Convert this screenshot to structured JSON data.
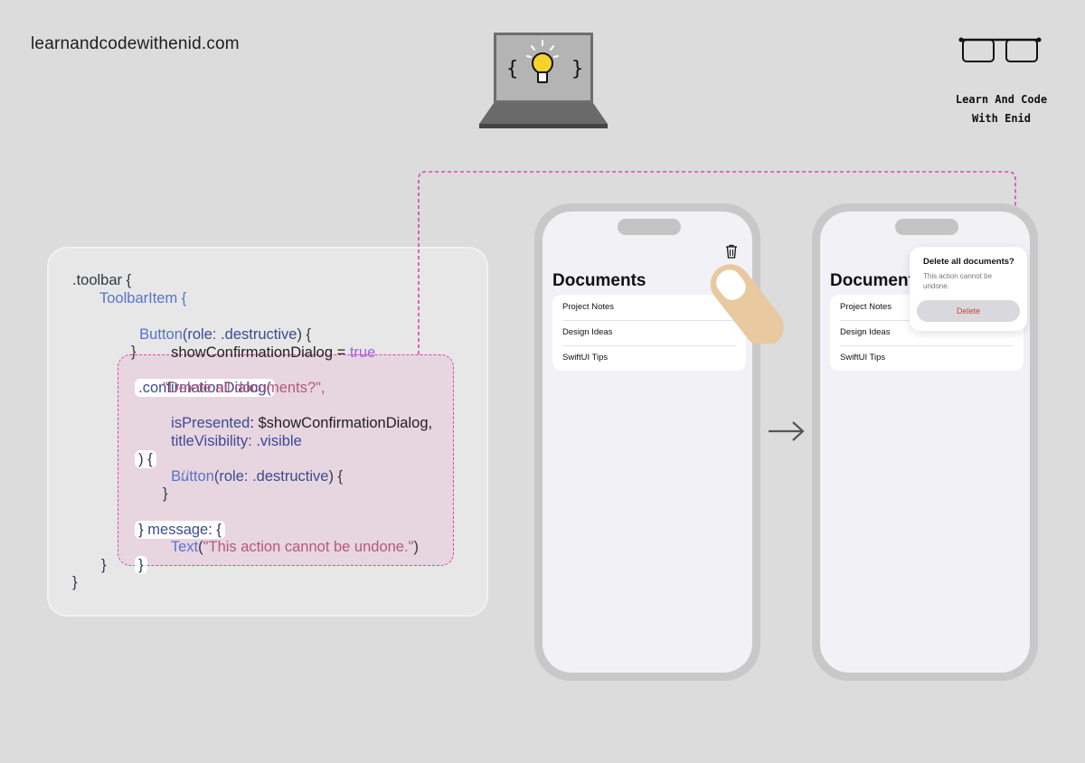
{
  "header": {
    "site_url": "learnandcodewithenid.com",
    "brand_line1": "Learn And Code",
    "brand_line2": "With Enid"
  },
  "code": {
    "l1": ".toolbar {",
    "l2": "ToolbarItem {",
    "l3_a": "Button",
    "l3_b": "(role: ",
    "l3_c": ".destructive",
    "l3_d": ") {",
    "l4_a": "showConfirmationDialog = ",
    "l4_b": "true",
    "l5": "}",
    "l6": ".confirmationDialog(",
    "l7": "\"Delete all documents?\",",
    "l8_a": "isPresented",
    "l8_b": ": $showConfirmationDialog,",
    "l9_a": "titleVisibility",
    "l9_b": ": .visible",
    "l10": ") {",
    "l11_a": "Button",
    "l11_b": "(role: ",
    "l11_c": ".destructive",
    "l11_d": ") {",
    "l12": "//",
    "l13": "}",
    "l14_a": "} ",
    "l14_b": "message",
    "l14_c": ": {",
    "l15_a": "Text",
    "l15_b": "(",
    "l15_c": "\"This action cannot be undone.\"",
    "l15_d": ")",
    "l16": "}",
    "l17": "}",
    "l18": "}"
  },
  "phone_before": {
    "title": "Documents",
    "items": [
      "Project Notes",
      "Design Ideas",
      "SwiftUI Tips"
    ]
  },
  "phone_after": {
    "title": "Documents",
    "items": [
      "Project Notes",
      "Design Ideas",
      "SwiftUI Tips"
    ],
    "dialog": {
      "title": "Delete all documents?",
      "message": "This action cannot be undone.",
      "button": "Delete"
    }
  },
  "colors": {
    "background": "#dcdcdc",
    "highlight_dash": "#dd44b5",
    "destructive": "#e0343e",
    "bulb": "#f7d22a"
  },
  "icons": [
    "laptop-lightbulb-icon",
    "glasses-icon",
    "trash-icon",
    "finger-tap-icon",
    "arrow-right-icon"
  ]
}
